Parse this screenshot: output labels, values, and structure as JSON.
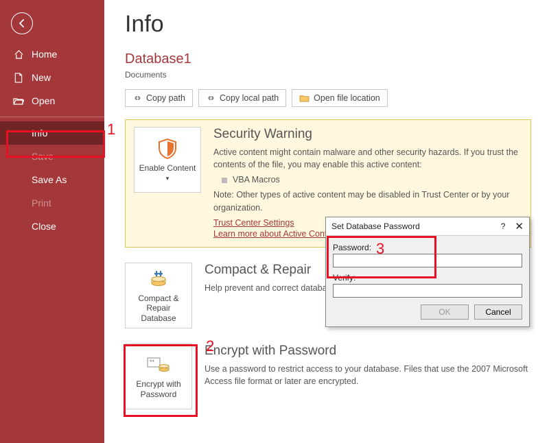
{
  "sidebar": {
    "items": [
      {
        "label": "Home",
        "name": "nav-home"
      },
      {
        "label": "New",
        "name": "nav-new"
      },
      {
        "label": "Open",
        "name": "nav-open"
      },
      {
        "label": "Info",
        "name": "nav-info",
        "selected": true
      },
      {
        "label": "Save",
        "name": "nav-save",
        "disabled": true
      },
      {
        "label": "Save As",
        "name": "nav-save-as"
      },
      {
        "label": "Print",
        "name": "nav-print",
        "disabled": true
      },
      {
        "label": "Close",
        "name": "nav-close"
      }
    ]
  },
  "page": {
    "title": "Info",
    "database_name": "Database1",
    "database_path": "Documents"
  },
  "toolbar": {
    "copy_path": "Copy path",
    "copy_local_path": "Copy local path",
    "open_file_location": "Open file location"
  },
  "security": {
    "tile_label": "Enable Content",
    "heading": "Security Warning",
    "line1": "Active content might contain malware and other security hazards. If you trust the contents of the file, you may enable this active content:",
    "bullet": "VBA Macros",
    "note": "Note: Other types of active content may be disabled in Trust Center or by your organization.",
    "link1": "Trust Center Settings",
    "link2": "Learn more about Active Content"
  },
  "compact": {
    "tile_label": "Compact & Repair Database",
    "heading": "Compact & Repair",
    "desc": "Help prevent and correct database file problems by using Compact and Repair."
  },
  "encrypt": {
    "tile_label": "Encrypt with Password",
    "heading": "Encrypt with Password",
    "desc": "Use a password to restrict access to your database. Files that use the 2007 Microsoft Access file format or later are encrypted."
  },
  "dialog": {
    "title": "Set Database Password",
    "password_label": "Password:",
    "verify_label": "Verify:",
    "ok": "OK",
    "cancel": "Cancel",
    "help": "?",
    "close": "✕"
  },
  "annotations": {
    "n1": "1",
    "n2": "2",
    "n3": "3"
  }
}
